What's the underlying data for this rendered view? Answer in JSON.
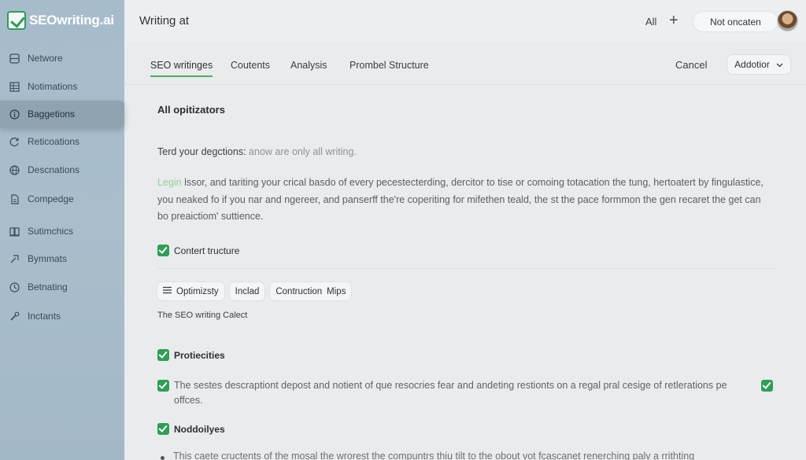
{
  "brand": {
    "name": "SEOwriting.ai",
    "accent": "#2f9e57"
  },
  "sidebar": {
    "items": [
      {
        "label": "Networe",
        "icon": "grid-icon"
      },
      {
        "label": "Notimations",
        "icon": "table-icon"
      },
      {
        "label": "Baggetions",
        "icon": "info-icon",
        "active": true
      },
      {
        "label": "Reticoations",
        "icon": "refresh-icon"
      },
      {
        "label": "Descnations",
        "icon": "globe-icon"
      },
      {
        "label": "Compedge",
        "icon": "file-icon"
      },
      {
        "label": "Sutimchics",
        "icon": "layers-icon"
      },
      {
        "label": "Bymmats",
        "icon": "link-icon"
      },
      {
        "label": "Betnating",
        "icon": "clock-icon"
      },
      {
        "label": "Inctants",
        "icon": "wrench-icon"
      }
    ]
  },
  "header": {
    "title": "Writing at",
    "all_label": "All",
    "add_icon": "plus-icon",
    "status_pill": "Not oncaten",
    "avatar": "user-avatar"
  },
  "tabs": {
    "items": [
      {
        "label": "SEO writinges",
        "active": true
      },
      {
        "label": "Coutents"
      },
      {
        "label": "Analysis"
      },
      {
        "label": "Prombel Structure"
      }
    ],
    "cancel_label": "Cancel",
    "add_label": "Addotior"
  },
  "main": {
    "section_title": "All opitizators",
    "intro_prefix": "Terd your degctions:",
    "intro_suffix": "anow are only all writing.",
    "para_lead": "Legin",
    "para_rest": "lssor, and tariting your crical basdo of every pecestecterding, dercitor to tise or comoing totacation the tung, hertoatert by fingulastice, you neaked fo if you nar and ngereer, and panserff the're coperiting for mifethen teald, the st the pace formmon the gen recaret the get can bo preaictiom' suttience.",
    "checks": {
      "content_structure": "Contert tructure",
      "proticities": "Protiecities",
      "description": "The sestes descraptiont depost and notient of que resocries fear and andeting restionts on a regal pral cesige of retlerations pe offces.",
      "noddoiliyes": "Noddoilyes"
    },
    "chips": [
      {
        "label": "Optimizsty",
        "icon": "list-icon"
      },
      {
        "label": "Inclad"
      },
      {
        "label": "Contruction"
      },
      {
        "label": "Mips"
      }
    ],
    "caption": "The SEO writing Calect",
    "bottom_text": "This caete cructents of the mosal the wrorest the compuntrs thiu tilt to the obout vot fcascanet renerching paly a rrithting"
  }
}
